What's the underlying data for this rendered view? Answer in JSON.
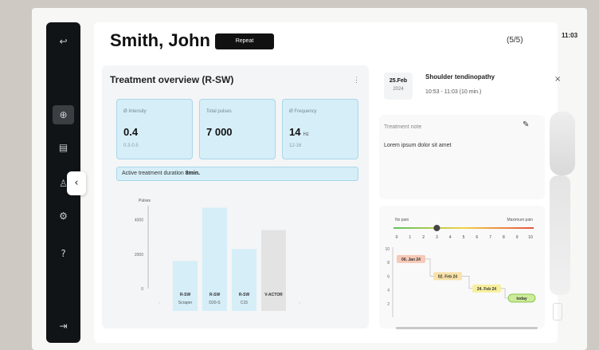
{
  "header": {
    "patient_name": "Smith, John",
    "repeat_label": "Repeat",
    "counter": "(5/5)",
    "clock": "11:03"
  },
  "sidebar": {
    "items": [
      {
        "icon": "back-arrow-icon",
        "glyph": "↩"
      },
      {
        "icon": "shockwave-icon",
        "glyph": "⊕"
      },
      {
        "icon": "clipboard-icon",
        "glyph": "▤"
      },
      {
        "icon": "body-icon",
        "glyph": "♙"
      },
      {
        "icon": "settings-icon",
        "glyph": "⚙"
      },
      {
        "icon": "help-icon",
        "glyph": "?"
      },
      {
        "icon": "logout-icon",
        "glyph": "⇥"
      }
    ],
    "collapse_glyph": "‹"
  },
  "overview": {
    "title": "Treatment overview (R-SW)",
    "menu_glyph": "⋮",
    "stats": [
      {
        "label": "Ø Intensity",
        "value": "0.4",
        "unit": "",
        "range": "0.3-0.5"
      },
      {
        "label": "Total pulses",
        "value": "7 000",
        "unit": "",
        "range": ""
      },
      {
        "label": "Ø Frequency",
        "value": "14",
        "unit": "Hz",
        "range": "12-16"
      }
    ],
    "duration_label": "Active treatment duration",
    "duration_value": "8min."
  },
  "chart_data": {
    "type": "bar",
    "ylabel": "Pulses",
    "yticks": [
      0,
      2000,
      4000
    ],
    "ylim": [
      0,
      5000
    ],
    "categories": [
      "R-SW",
      "R-SW",
      "R-SW",
      "V-ACTOR"
    ],
    "sublabels": [
      "Scraper",
      "D20-S",
      "C15",
      ""
    ],
    "values": [
      1600,
      4700,
      2300,
      3400
    ],
    "colors": [
      "#d5eef8",
      "#d5eef8",
      "#d5eef8",
      "#e3e3e3"
    ]
  },
  "session": {
    "date_day": "25.Feb",
    "date_year": "2024",
    "diagnosis": "Shoulder tendinopathy",
    "time_range": "10:53 - 11:03 (10 min.)"
  },
  "notes": {
    "label": "Treatment note",
    "text": "Lorem ipsum dolor sit amet",
    "edit_glyph": "✎"
  },
  "pain_scale": {
    "min_label": "No pain",
    "max_label": "Maximum pain",
    "scale": [
      "0",
      "1",
      "2",
      "3",
      "4",
      "5",
      "6",
      "7",
      "8",
      "9",
      "10"
    ],
    "marker_value": 3,
    "y_labels": [
      "10",
      "8",
      "6",
      "4",
      "2"
    ],
    "entries": [
      {
        "label": "06. Jan 24",
        "value": 8.5,
        "color": "#f6c9b7"
      },
      {
        "label": "02. Feb 24",
        "value": 6,
        "color": "#f8e2a8"
      },
      {
        "label": "24. Feb 24",
        "value": 4.2,
        "color": "#f7ef9e"
      },
      {
        "label": "today",
        "value": 2.8,
        "color": "#cdeb9b"
      }
    ]
  }
}
